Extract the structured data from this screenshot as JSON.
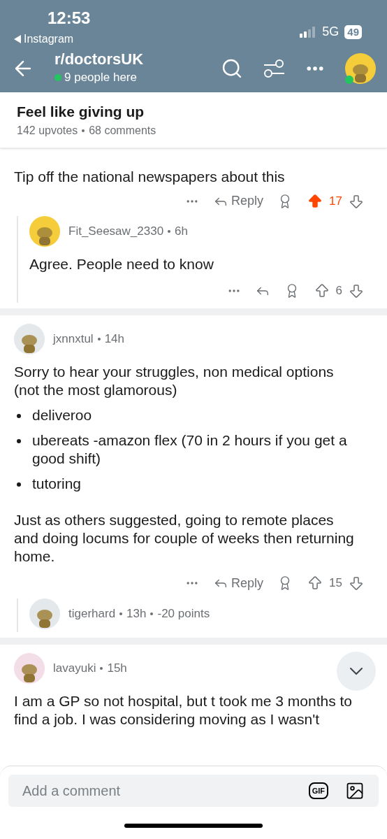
{
  "status_bar": {
    "time": "12:53",
    "back_app": "Instagram",
    "network": "5G",
    "battery": "49"
  },
  "header": {
    "title": "r/doctorsUK",
    "online": "9 people here"
  },
  "post": {
    "title": "Feel like giving up",
    "upvotes": "142 upvotes",
    "comments": "68 comments"
  },
  "comments": [
    {
      "kind": "partial",
      "blocks": [
        {
          "kind": "paragraph",
          "text": "Tip off the national newspapers about this"
        }
      ],
      "reply": "Reply",
      "votes": "17",
      "upvoted": true,
      "children": [
        {
          "kind": "full",
          "author": "Fit_Seesaw_2330",
          "time": "6h",
          "color": "#f5cd3a",
          "blocks": [
            {
              "kind": "paragraph",
              "text": "Agree. People need to know"
            }
          ],
          "votes": "6",
          "upvoted": false
        }
      ]
    },
    {
      "kind": "full",
      "author": "jxnnxtul",
      "time": "14h",
      "color": "#e4e8ea",
      "blocks": [
        {
          "kind": "paragraph",
          "text": "Sorry to hear your struggles, non medical options (not the most glamorous)"
        },
        {
          "kind": "bullet",
          "text": "deliveroo"
        },
        {
          "kind": "bullet",
          "text": "ubereats -amazon flex (70 in 2 hours if you get a good shift)"
        },
        {
          "kind": "bullet",
          "text": "tutoring"
        },
        {
          "kind": "paragraph",
          "text": "Just as others suggested, going to remote places and doing locums for couple of weeks then returning home."
        }
      ],
      "reply": "Reply",
      "votes": "15",
      "upvoted": false,
      "children": [
        {
          "kind": "collapsed",
          "author": "tigerhard",
          "time": "13h",
          "points": "-20 points",
          "color": "#e4e8ea"
        }
      ]
    },
    {
      "kind": "full",
      "author": "lavayuki",
      "time": "15h",
      "color": "#f3dde6",
      "blocks": [
        {
          "kind": "paragraph",
          "text": "I am a GP so not hospital, but t took me 3 months to find a job. I was considering moving as I wasn't"
        }
      ]
    }
  ],
  "composer": {
    "placeholder": "Add a comment",
    "gif_label": "GIF"
  }
}
